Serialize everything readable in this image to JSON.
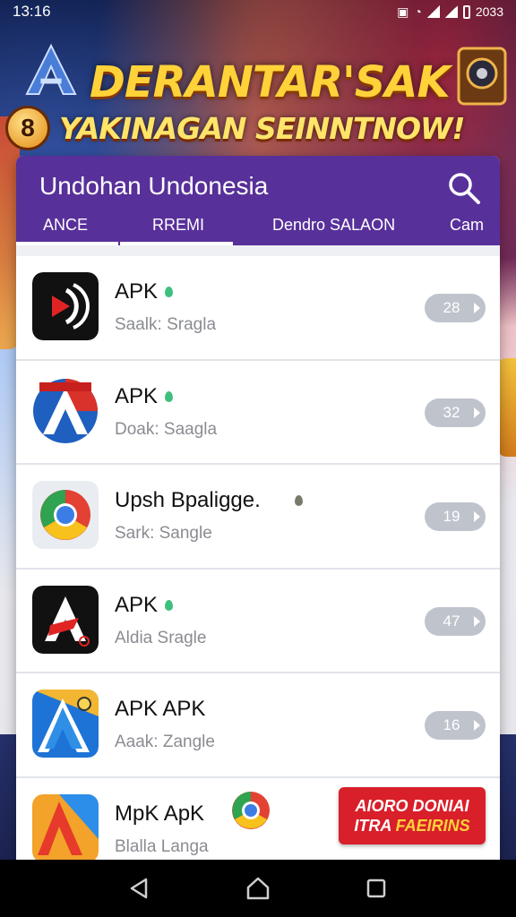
{
  "status_bar": {
    "time": "13:16",
    "right_text": "2033"
  },
  "banner": {
    "title": "DERANTAR'SAK",
    "subtitle": "YAKINAGAN SEINNTNOW!",
    "badge": "8",
    "logo_icon": "a-logo-icon",
    "chest_icon": "treasure-chest-icon"
  },
  "header": {
    "title": "Undohan Undonesia",
    "search_icon": "search-icon",
    "color": "#58309a"
  },
  "tabs": [
    {
      "label": "ANCE",
      "active": true
    },
    {
      "label": "RREMI",
      "active": true
    },
    {
      "label": "Dendro SALAON",
      "active": false
    },
    {
      "label": "Cam",
      "active": false
    }
  ],
  "apps": [
    {
      "name": "APK",
      "subtitle": "Saalk: Sragla",
      "count": "28",
      "icon": "red-play-icon"
    },
    {
      "name": "APK",
      "subtitle": "Doak: Saagla",
      "count": "32",
      "icon": "blue-a-globe-icon"
    },
    {
      "name": "Upsh Bpaligge.",
      "subtitle": "Sark: Sangle",
      "count": "19",
      "icon": "chrome-icon"
    },
    {
      "name": "APK",
      "subtitle": "Aldia Sragle",
      "count": "47",
      "icon": "red-a-icon"
    },
    {
      "name": "APK APK",
      "subtitle": "Aaak: Zangle",
      "count": "16",
      "icon": "blue-a-icon"
    },
    {
      "name": "MpK ApK",
      "subtitle": "Blalla Langa",
      "icon": "red-a-corner-icon"
    }
  ],
  "promo": {
    "line1": "AIORO DONIAI",
    "line2a": "ITRA ",
    "line2b": "FAEIRINS",
    "color": "#d81f2a"
  },
  "nav": {
    "back_icon": "back-triangle-icon",
    "home_icon": "home-icon",
    "recents_icon": "recents-square-icon"
  }
}
